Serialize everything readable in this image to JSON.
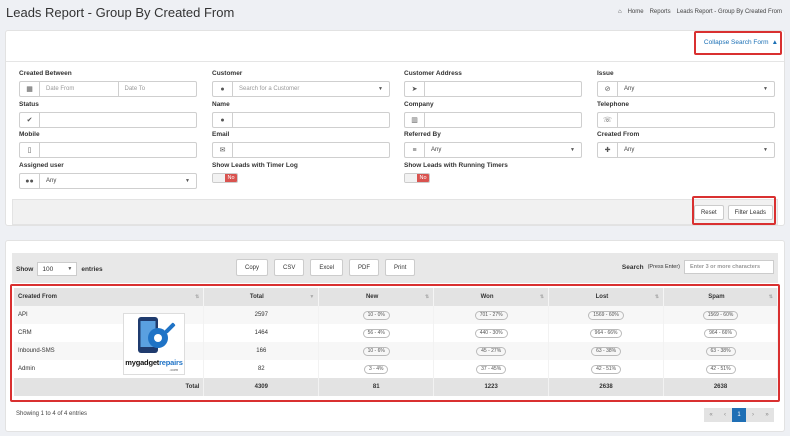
{
  "page": {
    "title": "Leads Report - Group By Created From"
  },
  "breadcrumb": {
    "home": "Home",
    "reports": "Reports",
    "current": "Leads Report - Group By Created From"
  },
  "search": {
    "collapse_label": "Collapse Search Form",
    "created_between": {
      "label": "Created Between",
      "from_placeholder": "Date From",
      "to_placeholder": "Date To"
    },
    "customer": {
      "label": "Customer",
      "placeholder": "Search for a Customer"
    },
    "customer_address": {
      "label": "Customer Address"
    },
    "issue": {
      "label": "Issue",
      "value": "Any"
    },
    "status": {
      "label": "Status"
    },
    "name": {
      "label": "Name"
    },
    "company": {
      "label": "Company"
    },
    "telephone": {
      "label": "Telephone"
    },
    "mobile": {
      "label": "Mobile"
    },
    "email": {
      "label": "Email"
    },
    "referred_by": {
      "label": "Referred By",
      "value": "Any"
    },
    "created_from": {
      "label": "Created From",
      "value": "Any"
    },
    "assigned_user": {
      "label": "Assigned user",
      "value": "Any"
    },
    "timer_log": {
      "label": "Show Leads with Timer Log",
      "state": "No"
    },
    "running_timers": {
      "label": "Show Leads with Running Timers",
      "state": "No"
    },
    "reset_label": "Reset",
    "filter_label": "Filter Leads"
  },
  "results": {
    "show_label": "Show",
    "entries_label": "entries",
    "page_length": "100",
    "export": {
      "copy": "Copy",
      "csv": "CSV",
      "excel": "Excel",
      "pdf": "PDF",
      "print": "Print"
    },
    "search_label": "Search",
    "search_hint": "(Press Enter)",
    "search_placeholder": "Enter 3 or more characters",
    "columns": [
      "Created From",
      "Total",
      "New",
      "Won",
      "Lost",
      "Spam"
    ],
    "rows": [
      {
        "source": "API",
        "total": "2597",
        "new": "10 - 0%",
        "won": "701 - 27%",
        "lost": "1569 - 60%",
        "spam": "1569 - 60%"
      },
      {
        "source": "CRM",
        "total": "1464",
        "new": "56 - 4%",
        "won": "440 - 30%",
        "lost": "964 - 66%",
        "spam": "964 - 66%"
      },
      {
        "source": "Inbound-SMS",
        "total": "166",
        "new": "10 - 6%",
        "won": "45 - 27%",
        "lost": "63 - 38%",
        "spam": "63 - 38%"
      },
      {
        "source": "Admin",
        "total": "82",
        "new": "3 - 4%",
        "won": "37 - 45%",
        "lost": "42 - 51%",
        "spam": "42 - 51%"
      }
    ],
    "footer": {
      "label": "Total",
      "total": "4309",
      "new": "81",
      "won": "1223",
      "lost": "2638",
      "spam": "2638"
    },
    "info": "Showing 1 to 4 of 4 entries",
    "pager": {
      "first": "«",
      "prev": "‹",
      "current": "1",
      "next": "›",
      "last": "»"
    }
  },
  "watermark": {
    "brand_a": "mygadget",
    "brand_b": "repairs",
    "domain": ".com"
  }
}
